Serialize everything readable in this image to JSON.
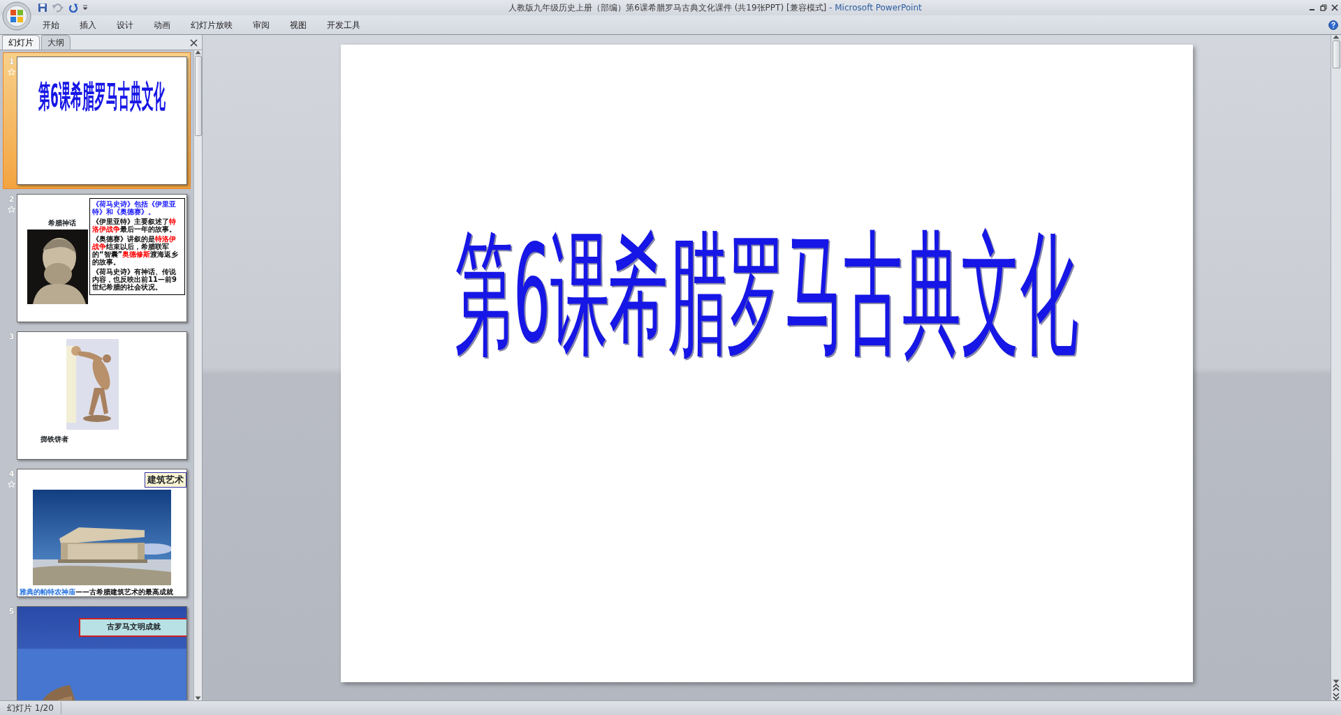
{
  "window": {
    "title": "人教版九年级历史上册（部编）第6课希腊罗马古典文化课件 (共19张PPT) [兼容模式]",
    "app": "- Microsoft PowerPoint"
  },
  "ribbon_tabs": [
    "开始",
    "插入",
    "设计",
    "动画",
    "幻灯片放映",
    "审阅",
    "视图",
    "开发工具"
  ],
  "panel_tabs": [
    {
      "label": "幻灯片",
      "selected": true
    },
    {
      "label": "大纲",
      "selected": false
    }
  ],
  "slides": [
    {
      "number": "1",
      "selected": true,
      "animated": true,
      "kind": "title",
      "title": "第6课希腊罗马古典文化"
    },
    {
      "number": "2",
      "selected": false,
      "animated": true,
      "kind": "text_image",
      "caption": "希腊神话",
      "paragraphs": [
        [
          {
            "text": "《荷马史诗》包括《伊里亚特》和《奥德赛》。",
            "color": "#1a1aff"
          }
        ],
        [
          {
            "text": "《伊里亚特》主要叙述了"
          },
          {
            "text": "特洛伊战争",
            "color": "#ff0000"
          },
          {
            "text": "最后一年的故事。"
          }
        ],
        [
          {
            "text": "《奥德赛》讲叙的是"
          },
          {
            "text": "特洛伊战争",
            "color": "#ff0000"
          },
          {
            "text": "结束以后，希腊联军的“智囊”"
          },
          {
            "text": "奥德修斯",
            "color": "#ff0000"
          },
          {
            "text": "渡海返乡的故事。"
          }
        ],
        [
          {
            "text": "《荷马史诗》有神话、传说内容，也反映出前11—前9世纪希腊的社会状况。"
          }
        ]
      ]
    },
    {
      "number": "3",
      "selected": false,
      "animated": false,
      "kind": "image_caption",
      "caption": "掷铁饼者"
    },
    {
      "number": "4",
      "selected": false,
      "animated": true,
      "kind": "banner_image",
      "banner": "建筑艺术",
      "footer_highlight": "雅典的帕特农神庙",
      "footer_rest": "——古希腊建筑艺术的最高成就"
    },
    {
      "number": "5",
      "selected": false,
      "animated": false,
      "kind": "scroll_image",
      "banner": "古罗马文明成就"
    }
  ],
  "current_slide": {
    "title": "第6课希腊罗马古典文化"
  },
  "status_bar": {
    "slide_info": "幻灯片 1/20"
  }
}
